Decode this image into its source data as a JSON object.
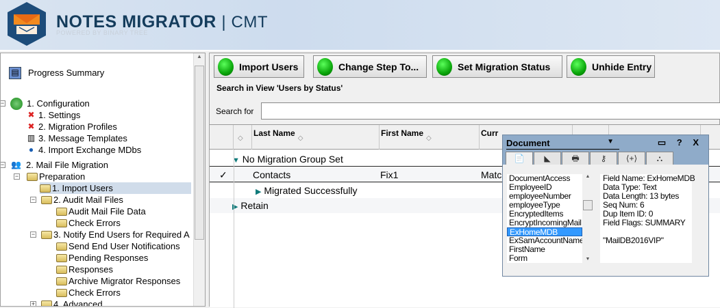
{
  "header": {
    "brand": "NOTES MIGRATOR",
    "separator": "|",
    "product": "CMT",
    "powered_by": "POWERED BY BINARY TREE"
  },
  "tree": {
    "progress_summary": "Progress Summary",
    "configuration": "1. Configuration",
    "config_items": [
      "1. Settings",
      "2. Migration Profiles",
      "3. Message Templates",
      "4. Import Exchange MDbs"
    ],
    "mail_file_migration": "2. Mail File Migration",
    "preparation": "Preparation",
    "import_users": "1. Import Users",
    "audit_mail_files": "2. Audit Mail Files",
    "audit_children": [
      "Audit Mail File Data",
      "Check Errors"
    ],
    "notify": "3. Notify End Users for Required A",
    "notify_children": [
      "Send End User Notifications",
      "Pending Responses",
      "Responses",
      "Archive Migrator Responses",
      "Check Errors"
    ],
    "advanced": "4. Advanced"
  },
  "toolbar": {
    "buttons": [
      "Import Users",
      "Change Step To...",
      "Set Migration Status",
      "Unhide Entry"
    ]
  },
  "search": {
    "view_label": "Search in View 'Users by Status'",
    "label": "Search for",
    "value": ""
  },
  "grid": {
    "columns": [
      "Last Name",
      "First Name",
      "Curr"
    ],
    "rows": {
      "group1": "No Migration Group Set",
      "contact_last": "Contacts",
      "contact_first": "Fix1",
      "contact_step": "Matc",
      "check": "✓",
      "subgroup": "Migrated Successfully",
      "group2": "Retain"
    }
  },
  "properties": {
    "title": "Document",
    "controls": "▭ ? X",
    "tabs": [
      "📄",
      "◣",
      "🖶",
      "⚷",
      "⟨+⟩",
      "⛬"
    ],
    "fields": [
      "DocumentAccess",
      "EmployeeID",
      "employeeNumber",
      "employeeType",
      "EncryptedItems",
      "EncryptIncomingMail",
      "ExHomeMDB",
      "ExSamAccountName",
      "FirstName",
      "Form"
    ],
    "selected_field": "ExHomeMDB",
    "info": [
      "Field Name: ExHomeMDB",
      "Data Type: Text",
      "Data Length: 13 bytes",
      "Seq Num: 6",
      "Dup Item ID: 0",
      "Field Flags: SUMMARY",
      "",
      "\"MailDB2016VIP\""
    ]
  }
}
